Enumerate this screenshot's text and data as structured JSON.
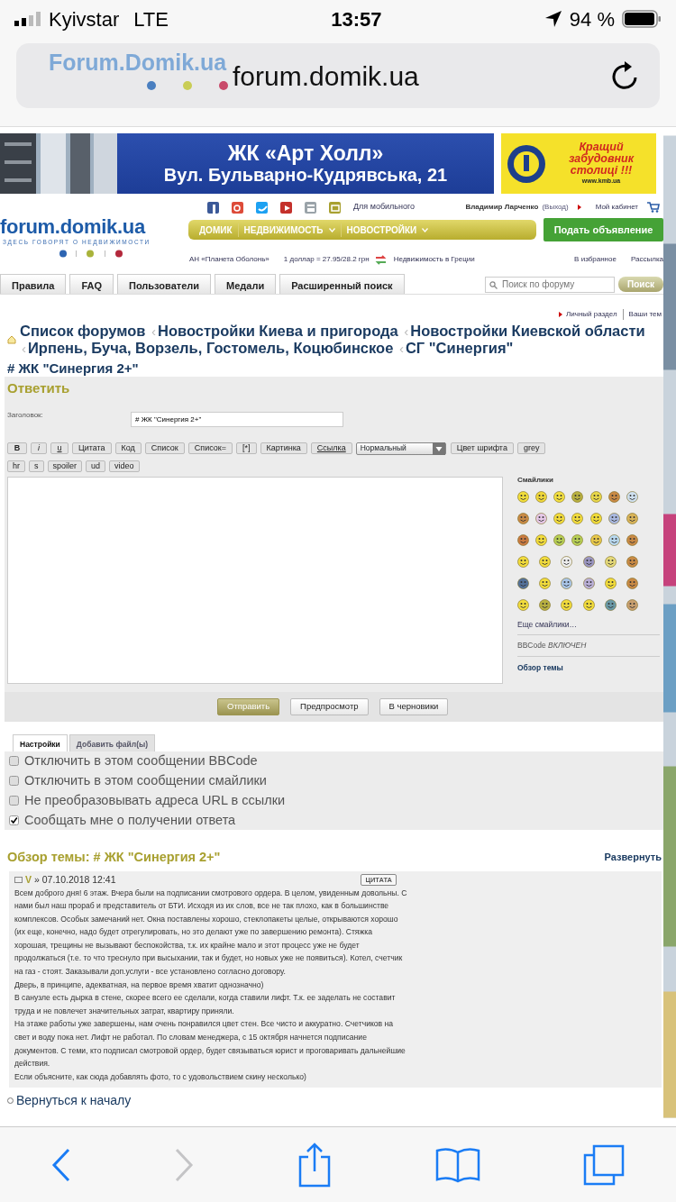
{
  "status_bar": {
    "carrier": "Kyivstar",
    "network": "LTE",
    "time": "13:57",
    "battery": "94 %"
  },
  "address_bar": {
    "logo_text": "Forum.Domik.ua",
    "url": "forum.domik.ua"
  },
  "banner": {
    "headline": "ЖК «Арт Холл»",
    "address": "Вул. Бульварно-Кудрявська, 21",
    "ad_slogan": "Кращий забудовник столиці !!!",
    "ad_url": "www.kmb.ua"
  },
  "header": {
    "mobile_link": "Для мобильного",
    "user": "Владимир Ларченко",
    "logout": "(Выход)",
    "cabinet": "Мой кабинет",
    "logo": "forum.domik.ua",
    "tagline": "ЗДЕСЬ ГОВОРЯТ О НЕДВИЖИМОСТИ",
    "nav": [
      {
        "label": "ДОМИК",
        "dropdown": false
      },
      {
        "label": "НЕДВИЖИМОСТЬ",
        "dropdown": true
      },
      {
        "label": "НОВОСТРОЙКИ",
        "dropdown": true
      }
    ],
    "post_ad": "Подать объявление",
    "agency": "АН «Планета Оболонь»",
    "rate": "1 доллар = 27.95/28.2 грн",
    "greece": "Недвижимость в Греции",
    "favorites": "В избранное",
    "newsletter": "Рассылка"
  },
  "menu_tabs": [
    "Правила",
    "FAQ",
    "Пользователи",
    "Медали",
    "Расширенный поиск"
  ],
  "search": {
    "placeholder": "Поиск по форуму",
    "button": "Поиск"
  },
  "user_links": [
    "Личный раздел",
    "Ваши тем"
  ],
  "breadcrumb": {
    "separator": "‹",
    "items": [
      "Список форумов",
      "Новостройки Киева и пригорода",
      "Новостройки Киевской области",
      "Ирпень, Буча, Ворзель, Гостомель, Коцюбинское",
      "СГ \"Синергия\""
    ]
  },
  "topic_title": "# ЖК \"Синергия 2+\"",
  "reply": {
    "heading": "Ответить",
    "subject_label": "Заголовок:",
    "subject_value": "# ЖК \"Синергия 2+\"",
    "toolbar": [
      {
        "label": "B",
        "kind": "bold"
      },
      {
        "label": "i",
        "kind": "italic"
      },
      {
        "label": "u",
        "kind": "underline"
      },
      {
        "label": "Цитата",
        "kind": "plain"
      },
      {
        "label": "Код",
        "kind": "plain"
      },
      {
        "label": "Список",
        "kind": "plain"
      },
      {
        "label": "Список=",
        "kind": "plain"
      },
      {
        "label": "[*]",
        "kind": "plain"
      },
      {
        "label": "Картинка",
        "kind": "plain"
      },
      {
        "label": "Ссылка",
        "kind": "underline"
      }
    ],
    "font_size": "Нормальный",
    "font_color": "Цвет шрифта",
    "grey": "grey",
    "toolbar2": [
      "hr",
      "s",
      "spoiler",
      "ud",
      "video"
    ],
    "smilies_heading": "Смайлики",
    "more_smilies": "Еще смайлики…",
    "bbcode": "BBCode *ВКЛЮЧЕН*",
    "review_link": "Обзор темы",
    "buttons": [
      {
        "label": "Отправить",
        "kind": "primary"
      },
      {
        "label": "Предпросмотр",
        "kind": "secondary"
      },
      {
        "label": "В черновики",
        "kind": "secondary"
      }
    ],
    "tabs": [
      {
        "label": "Настройки",
        "selected": true
      },
      {
        "label": "Добавить файл(ы)",
        "selected": false
      }
    ],
    "options": [
      {
        "label": "Отключить в этом сообщении BBCode",
        "checked": false
      },
      {
        "label": "Отключить в этом сообщении смайлики",
        "checked": false
      },
      {
        "label": "Не преобразовывать адреса URL в ссылки",
        "checked": false
      },
      {
        "label": "Сообщать мне о получении ответа",
        "checked": true
      }
    ]
  },
  "review": {
    "heading": "Обзор темы: # ЖК \"Синергия 2+\"",
    "expand": "Развернуть",
    "posts": [
      {
        "author": "V",
        "date": "» 07.10.2018 12:41",
        "quote": "ЦИТАТА",
        "paragraphs": [
          "Всем доброго дня! 6 этаж. Вчера были на подписании смотрового ордера. В целом, увиденным довольны. С нами был наш прораб и представитель от БТИ. Исходя из их слов, все не так плохо, как в большинстве комплексов. Особых замечаний нет. Окна поставлены хорошо, стеклопакеты целые, открываются хорошо (их еще, конечно, надо будет отрегулировать, но это делают уже по завершению ремонта). Стяжка хорошая, трещины не вызывают беспокойства, т.к. их крайне мало и этот процесс уже не будет продолжаться (т.е. то что треснуло при высыхании, так и будет, но новых уже не появиться). Котел, счетчик на газ - стоят. Заказывали доп.услуги - все установлено согласно договору.",
          "Дверь, в принципе, адекватная, на первое время хватит однозначно)",
          "В санузле есть дырка в стене, скорее всего ее сделали, когда ставили лифт. Т.к. ее заделать не составит труда и не повлечет значительных затрат, квартиру приняли.",
          "На этаже работы уже завершены, нам очень понравился цвет стен. Все чисто и аккуратно. Счетчиков на свет и воду пока нет. Лифт не работал. По словам менеджера, с 15 октября начнется подписание документов. С теми, кто подписал смотровой ордер, будет связываться юрист и проговаривать дальнейшие действия.",
          "Если объясните, как сюда добавлять фото, то с удовольствием скину несколько)"
        ]
      }
    ]
  },
  "back_to_top": "Вернуться к началу",
  "browser_toolbar": {
    "back_disabled": false,
    "forward_disabled": true
  }
}
